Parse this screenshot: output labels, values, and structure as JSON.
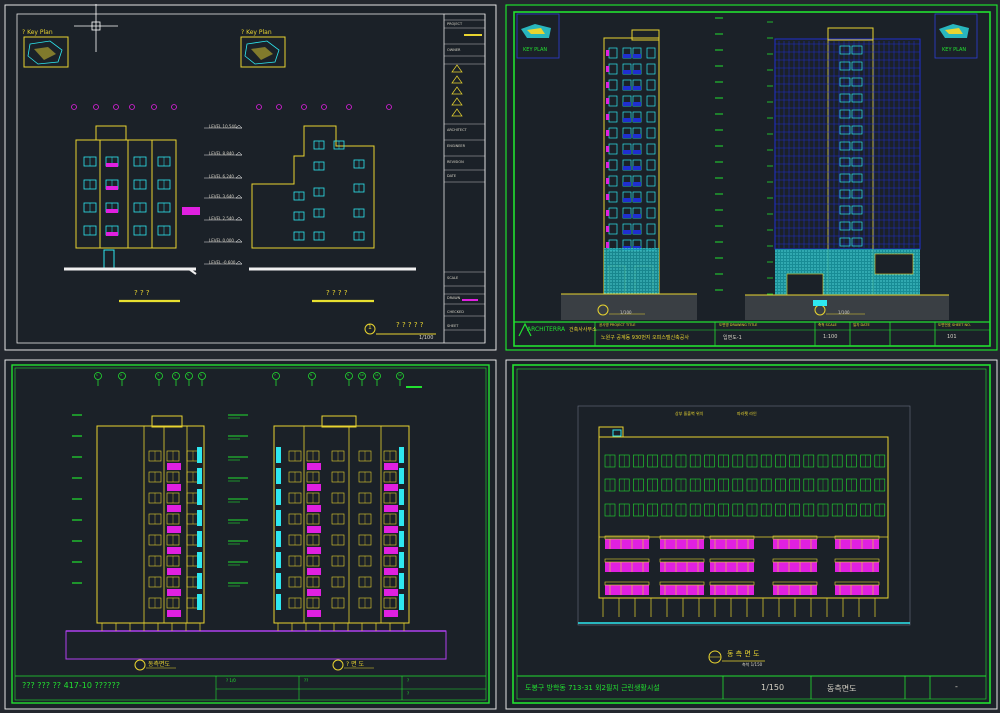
{
  "app": {
    "title": "Elevation drawings"
  },
  "colors": {
    "background": "#23272e",
    "sheet": "#1b2128",
    "frame_white": "#e8e8e8",
    "frame_green": "#22e030",
    "building_yellow": "#e8d430",
    "window_cyan": "#2ee8f0",
    "balcony_magenta": "#e020e0",
    "screen_blue": "#1f2fd0",
    "ground_white": "#f0f0f0"
  },
  "sheet1": {
    "key_plan_left": "? Key Plan",
    "key_plan_right": "? Key Plan",
    "level_tags": [
      "LEVEL 10,540",
      "LEVEL 8,840",
      "LEVEL 6,240",
      "LEVEL 3,640",
      "LEVEL 2,540",
      "LEVEL 0,000",
      "LEVEL -0,600"
    ],
    "caption_left": "? ? ?",
    "caption_right": "? ? ? ?",
    "bubble_number": "1",
    "bubble_title": "? ? ? ? ?",
    "bubble_scale": "1/100",
    "title_block_rows": [
      "PROJECT",
      "OWNER",
      "ARCHITECT",
      "ENGINEER",
      "REVISION",
      "DATE",
      "SCALE",
      "DRAWN",
      "CHECKED",
      "SHEET"
    ]
  },
  "sheet2": {
    "key_plan_left": "KEY PLAN",
    "key_plan_right": "KEY PLAN",
    "scale_label": "1/100",
    "logo": "ARCHITERRA",
    "logo_sub": "건축사사무소",
    "project_title": "노원구 공계동 930번지 오피스텔신축공사",
    "drawing_title": "입면도-1",
    "scale_value": "1:100",
    "sheet_number": "101",
    "header_cells": [
      "공사명 PROJECT TITLE",
      "도면명 DRAWING TITLE",
      "축척 SCALE",
      "일자 DATE",
      "도면번호 SHEET NO."
    ]
  },
  "sheet3": {
    "caption_left": "동측면도",
    "caption_right": "? 면 도",
    "footer_text": "??? ??? ?? 417-10 ??????",
    "footer_cells": [
      "? 1/0",
      "??",
      "?",
      "?"
    ],
    "grid_markers_left": [
      "1",
      "2",
      "3",
      "4",
      "5",
      "6"
    ],
    "grid_markers_right": [
      "7",
      "8",
      "9",
      "10",
      "11",
      "12"
    ]
  },
  "sheet4": {
    "label_top_left": "상부 돌출벽 위치",
    "label_top_right": "파라펫 라인",
    "caption": "동 측 면 도",
    "caption_scale": "축척 1/150",
    "footer_project": "도봉구 방학동 713-31 외2필지 근린생활시설",
    "footer_scale": "1/150",
    "footer_title": "동측면도",
    "footer_sheet": "-"
  }
}
